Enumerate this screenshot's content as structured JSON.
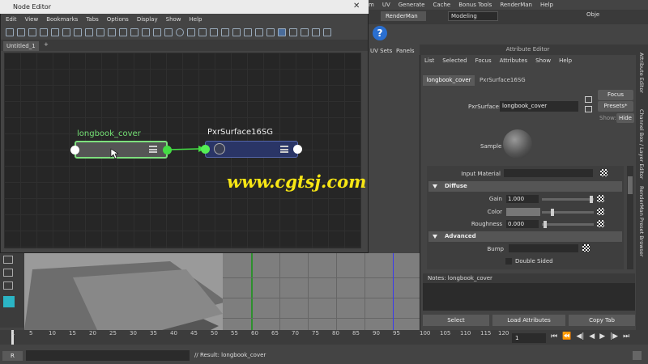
{
  "maya_menu": [
    "m",
    "UV",
    "Generate",
    "Cache",
    "Bonus Tools",
    "RenderMan",
    "Help"
  ],
  "shelf": {
    "renderman_tab": "RenderMan",
    "workspace": "Modeling",
    "objects": "Obje"
  },
  "node_editor": {
    "title": "Node Editor",
    "menu": [
      "Edit",
      "View",
      "Bookmarks",
      "Tabs",
      "Options",
      "Display",
      "Show",
      "Help"
    ],
    "tab_label": "Untitled_1",
    "add_tab": "+",
    "node_source_label": "longbook_cover",
    "node_target_label": "PxrSurface16SG"
  },
  "watermark": "www.cgtsj.com",
  "uv_panels": [
    "UV Sets",
    "Panels"
  ],
  "attribute_editor": {
    "title": "Attribute Editor",
    "menu": [
      "List",
      "Selected",
      "Focus",
      "Attributes",
      "Show",
      "Help"
    ],
    "tabs": [
      "longbook_cover",
      "PxrSurface16SG"
    ],
    "pxr_label": "PxrSurface:",
    "pxr_value": "longbook_cover",
    "focus_btn": "Focus",
    "presets_btn": "Presets*",
    "show_label": "Show:",
    "hide_btn": "Hide",
    "sample_label": "Sample",
    "input_material_label": "Input Material",
    "diffuse_section": "Diffuse",
    "gain_label": "Gain",
    "gain_value": "1.000",
    "color_label": "Color",
    "roughness_label": "Roughness",
    "roughness_value": "0.000",
    "advanced_section": "Advanced",
    "bump_label": "Bump",
    "double_sided_label": "Double Sided",
    "notes_label": "Notes:  longbook_cover",
    "select_btn": "Select",
    "load_attrs_btn": "Load Attributes",
    "copy_tab_btn": "Copy Tab"
  },
  "right_tabs": [
    "Attribute Editor",
    "Channel Box / Layer Editor",
    "RenderMan Preset Browser"
  ],
  "timeline": {
    "ticks": [
      "1",
      "5",
      "10",
      "15",
      "20",
      "25",
      "30",
      "35",
      "40",
      "45",
      "50",
      "55",
      "60",
      "65",
      "70",
      "75",
      "80",
      "85",
      "90",
      "95",
      "100",
      "105",
      "110",
      "115",
      "120"
    ],
    "current_frame": "1"
  },
  "command_line": {
    "mel_label": "R",
    "result": "// Result: longbook_cover"
  },
  "colors": {
    "selected_node_border": "#7ee07e",
    "shader_node": "#2a3566",
    "watermark": "#f7e614"
  }
}
